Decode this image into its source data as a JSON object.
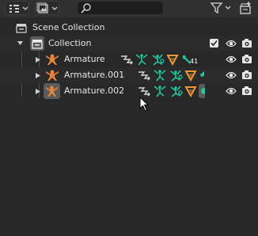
{
  "header": {
    "display_mode_icon": "outliner-display-mode-icon",
    "filter_icon": "funnel-icon",
    "new_collection_icon": "new-collection-icon",
    "search": {
      "value": "",
      "placeholder": ""
    }
  },
  "tree": {
    "scene_collection": {
      "label": "Scene Collection"
    },
    "collection": {
      "label": "Collection"
    },
    "items": [
      {
        "label": "Armature",
        "badge": "41"
      },
      {
        "label": "Armature.001"
      },
      {
        "label": "Armature.002"
      }
    ]
  },
  "colors": {
    "background": "#282828",
    "armature_orange": "#e8833a",
    "pose_green": "#22c7a0",
    "mesh_orange": "#e89a3a",
    "selected_icon_bg": "#5a5a5a"
  }
}
